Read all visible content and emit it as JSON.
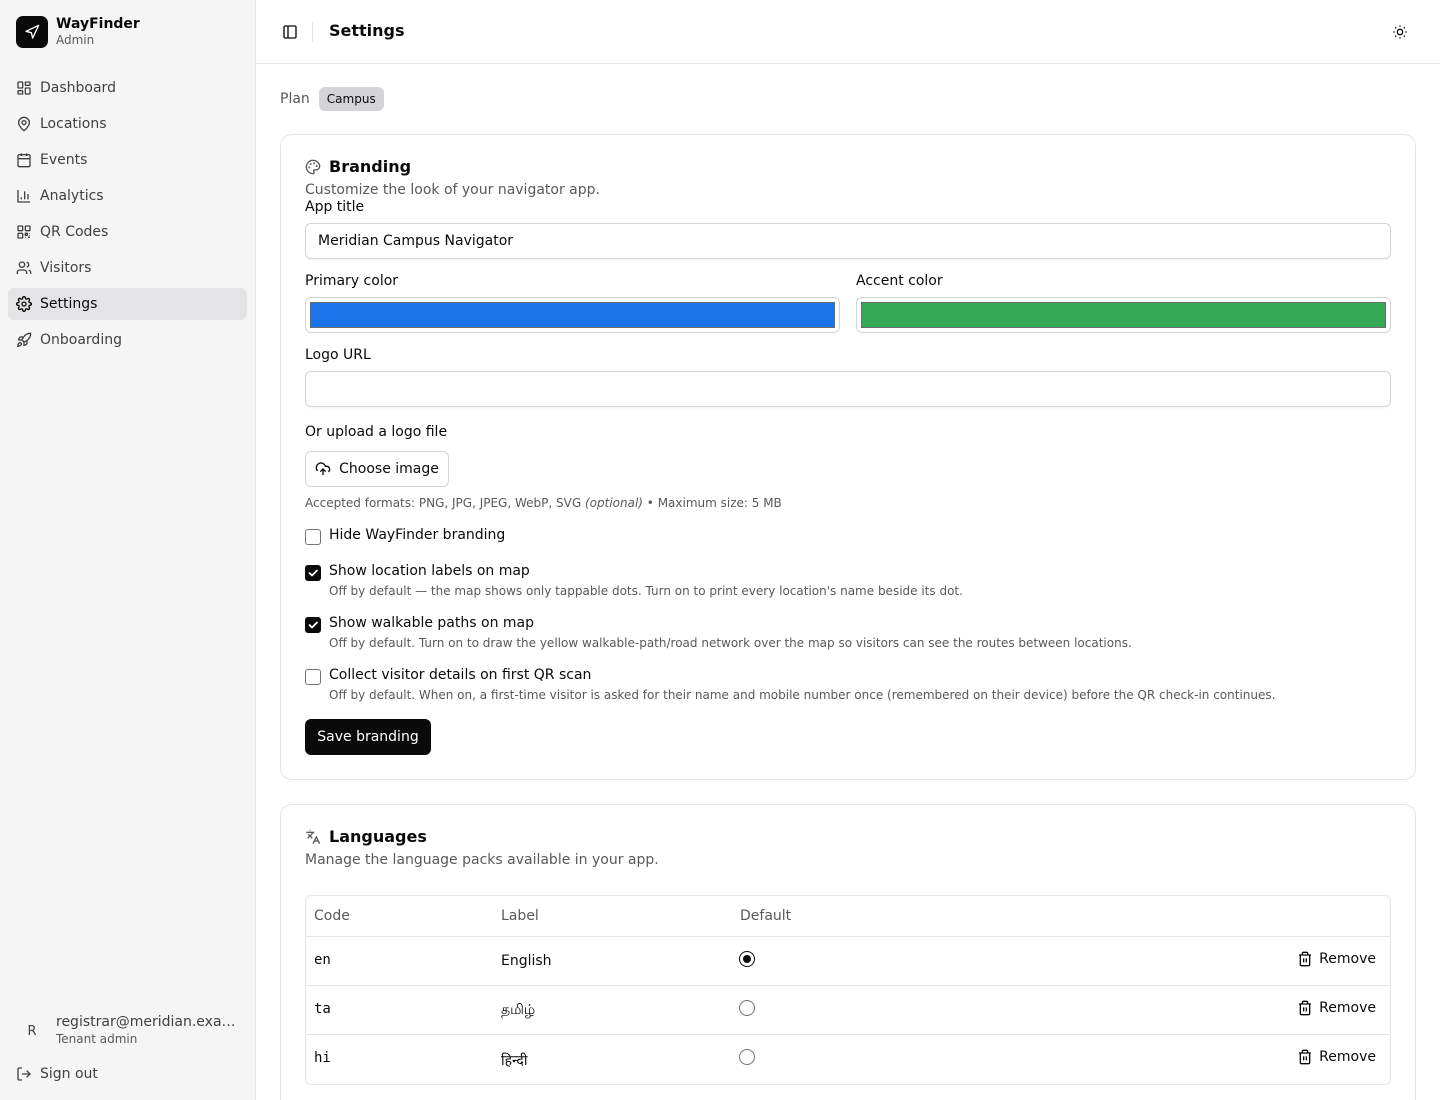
{
  "app": {
    "name": "WayFinder",
    "role": "Admin"
  },
  "sidebar": {
    "items": [
      {
        "label": "Dashboard",
        "icon": "dashboard-icon"
      },
      {
        "label": "Locations",
        "icon": "map-pin-icon"
      },
      {
        "label": "Events",
        "icon": "calendar-icon"
      },
      {
        "label": "Analytics",
        "icon": "bar-chart-icon"
      },
      {
        "label": "QR Codes",
        "icon": "qr-code-icon"
      },
      {
        "label": "Visitors",
        "icon": "users-icon"
      },
      {
        "label": "Settings",
        "icon": "gear-icon",
        "active": true
      },
      {
        "label": "Onboarding",
        "icon": "rocket-icon"
      }
    ],
    "user": {
      "initial": "R",
      "email": "registrar@meridian.example.edu",
      "role": "Tenant admin"
    },
    "signout": "Sign out"
  },
  "header": {
    "title": "Settings"
  },
  "plan": {
    "label": "Plan",
    "value": "Campus"
  },
  "branding": {
    "title": "Branding",
    "description": "Customize the look of your navigator app.",
    "app_title_label": "App title",
    "app_title_value": "Meridian Campus Navigator",
    "primary_color_label": "Primary color",
    "primary_color": "#1a73e8",
    "accent_color_label": "Accent color",
    "accent_color": "#34a853",
    "logo_url_label": "Logo URL",
    "logo_url_value": "",
    "upload_label": "Or upload a logo file",
    "choose_image": "Choose image",
    "formats_text": "Accepted formats: PNG, JPG, JPEG, WebP, SVG",
    "optional_text": "(optional)",
    "max_size_text": "• Maximum size: 5 MB",
    "options": [
      {
        "label": "Hide WayFinder branding",
        "checked": false,
        "help": ""
      },
      {
        "label": "Show location labels on map",
        "checked": true,
        "help": "Off by default — the map shows only tappable dots. Turn on to print every location's name beside its dot."
      },
      {
        "label": "Show walkable paths on map",
        "checked": true,
        "help": "Off by default. Turn on to draw the yellow walkable-path/road network over the map so visitors can see the routes between locations."
      },
      {
        "label": "Collect visitor details on first QR scan",
        "checked": false,
        "help": "Off by default. When on, a first-time visitor is asked for their name and mobile number once (remembered on their device) before the QR check-in continues."
      }
    ],
    "save_label": "Save branding"
  },
  "languages": {
    "title": "Languages",
    "description": "Manage the language packs available in your app.",
    "columns": [
      "Code",
      "Label",
      "Default"
    ],
    "rows": [
      {
        "code": "en",
        "label": "English",
        "default": true,
        "action": "Remove"
      },
      {
        "code": "ta",
        "label": "தமிழ்",
        "default": false,
        "action": "Remove"
      },
      {
        "code": "hi",
        "label": "हिन्दी",
        "default": false,
        "action": "Remove"
      }
    ]
  }
}
